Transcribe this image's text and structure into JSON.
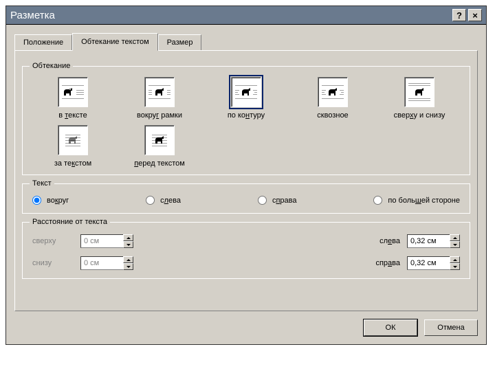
{
  "title": "Разметка",
  "titlebar_help": "?",
  "titlebar_close": "×",
  "tabs": {
    "position": "Положение",
    "wrapping": "Обтекание текстом",
    "size": "Размер"
  },
  "groups": {
    "wrapping": "Обтекание",
    "text": "Текст",
    "distance": "Расстояние от текста"
  },
  "wrap_options": {
    "inline": "в тексте",
    "square": "вокруг рамки",
    "tight": "по контуру",
    "through": "сквозное",
    "top_bottom": "сверху и снизу",
    "behind": "за текстом",
    "front": "перед текстом"
  },
  "text_align": {
    "around": "вокруг",
    "left": "слева",
    "right": "справа",
    "largest": "по большей стороне"
  },
  "distance": {
    "top_label": "сверху",
    "bottom_label": "снизу",
    "left_label": "слева",
    "right_label": "справа",
    "top_value": "0 см",
    "bottom_value": "0 см",
    "left_value": "0,32 см",
    "right_value": "0,32 см"
  },
  "buttons": {
    "ok": "ОК",
    "cancel": "Отмена"
  }
}
